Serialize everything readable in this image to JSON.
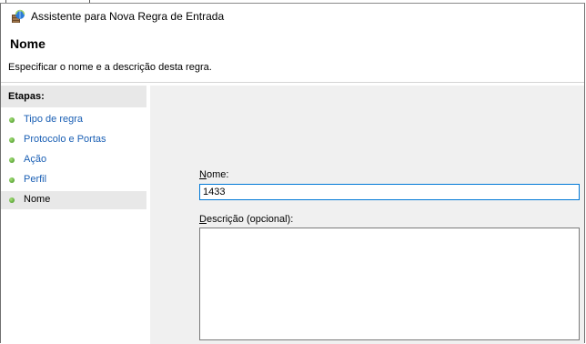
{
  "window": {
    "title": "Assistente para Nova Regra de Entrada",
    "icon": "firewall-shield-icon"
  },
  "header": {
    "title": "Nome",
    "subtitle": "Especificar o nome e a descrição desta regra."
  },
  "steps": {
    "heading": "Etapas:",
    "items": [
      {
        "label": "Tipo de regra",
        "current": false
      },
      {
        "label": "Protocolo e Portas",
        "current": false
      },
      {
        "label": "Ação",
        "current": false
      },
      {
        "label": "Perfil",
        "current": false
      },
      {
        "label": "Nome",
        "current": true
      }
    ],
    "dot_color": "#3b8f1c",
    "link_color": "#1a5fb4"
  },
  "form": {
    "name_label_mnemonic": "N",
    "name_label_rest": "ome:",
    "name_value": "1433",
    "description_label_mnemonic": "D",
    "description_label_rest": "escrição (opcional):",
    "description_value": ""
  },
  "colors": {
    "focus_border": "#0078d7",
    "pane_background": "#f0f0f0",
    "selected_step_background": "#e8e8e8"
  }
}
